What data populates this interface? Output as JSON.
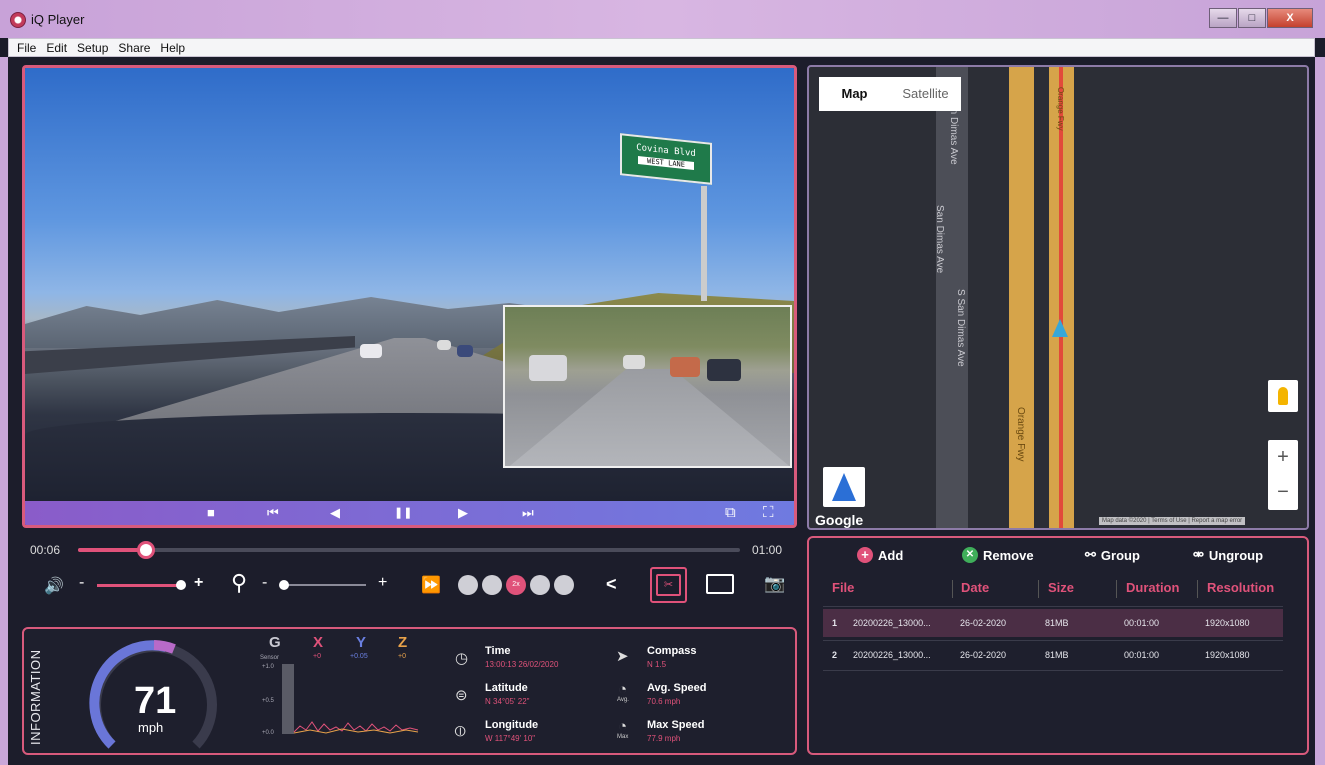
{
  "window": {
    "title": "iQ Player",
    "minimize": "—",
    "maximize": "□",
    "close": "X"
  },
  "menu": [
    "File",
    "Edit",
    "Setup",
    "Share",
    "Help"
  ],
  "video": {
    "sign_text": "Covina Blvd",
    "sign_sub": "WEST LANE",
    "controls": {
      "stop": "■",
      "prev": "⏮",
      "rewind": "◀",
      "pause": "❚❚",
      "step": "▶",
      "next": "⏭",
      "pip": "⧉",
      "fullscreen": "⛶"
    }
  },
  "timeline": {
    "current": "00:06",
    "end": "01:00",
    "progress": 0.1
  },
  "volume": {
    "icon": "🔊",
    "minus": "-",
    "plus": "+",
    "level": 1.0
  },
  "zoom": {
    "icon": "⚲",
    "minus": "-",
    "plus": "+",
    "level": 0.0
  },
  "playback": {
    "ff_icon": "⏩",
    "active_speed": "2x",
    "share_icon": "<",
    "snapshot_icon": "📷"
  },
  "info": {
    "label": "INFORMATION",
    "speed": "71",
    "speed_unit": "mph",
    "gauge_level": 0.6,
    "gsensor": {
      "g": "G",
      "sensor_label": "Sensor",
      "x": "X",
      "x_val": "+0",
      "y": "Y",
      "y_val": "+0.05",
      "z": "Z",
      "z_val": "+0",
      "ticks": [
        "+1.0",
        "+0.5",
        "+0.0"
      ]
    },
    "time_label": "Time",
    "time_value": "13:00:13  26/02/2020",
    "latitude_label": "Latitude",
    "latitude_value": "N 34°05' 22\"",
    "longitude_label": "Longitude",
    "longitude_value": "W 117°49' 10\"",
    "compass_label": "Compass",
    "compass_value": "N   1.5",
    "avg_label": "Avg. Speed",
    "avg_tag": "Avg.",
    "avg_value": "70.6 mph",
    "max_label": "Max Speed",
    "max_tag": "Max",
    "max_value": "77.9 mph"
  },
  "map": {
    "tab_map": "Map",
    "tab_satellite": "Satellite",
    "streets": [
      "S San Dimas Ave",
      "San Dimas Ave",
      "S San Dimas Ave",
      "Orange Fwy",
      "Orange Fwy"
    ],
    "zoom_in": "+",
    "zoom_out": "−",
    "logo": "Google",
    "attribution": "Map data ©2020 | Terms of Use | Report a map error"
  },
  "files": {
    "actions": {
      "add": "Add",
      "remove": "Remove",
      "group": "Group",
      "ungroup": "Ungroup"
    },
    "columns": [
      "File",
      "Date",
      "Size",
      "Duration",
      "Resolution"
    ],
    "rows": [
      {
        "num": "1",
        "file": "20200226_13000...",
        "date": "26-02-2020",
        "size": "81MB",
        "duration": "00:01:00",
        "resolution": "1920x1080"
      },
      {
        "num": "2",
        "file": "20200226_13000...",
        "date": "26-02-2020",
        "size": "81MB",
        "duration": "00:01:00",
        "resolution": "1920x1080"
      }
    ]
  }
}
